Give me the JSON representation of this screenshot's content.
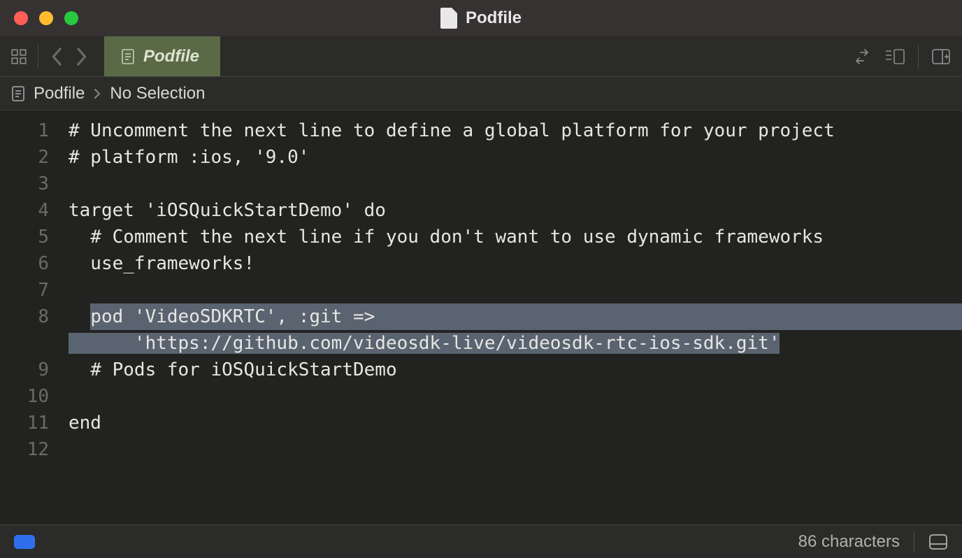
{
  "window": {
    "title": "Podfile"
  },
  "tab": {
    "label": "Podfile"
  },
  "breadcrumb": {
    "file": "Podfile",
    "sub": "No Selection"
  },
  "statusbar": {
    "chars": "86 characters"
  },
  "code": {
    "lines": [
      {
        "n": "1",
        "t": "# Uncomment the next line to define a global platform for your project"
      },
      {
        "n": "2",
        "t": "# platform :ios, '9.0'"
      },
      {
        "n": "3",
        "t": ""
      },
      {
        "n": "4",
        "t": "target 'iOSQuickStartDemo' do"
      },
      {
        "n": "5",
        "t": "  # Comment the next line if you don't want to use dynamic frameworks"
      },
      {
        "n": "6",
        "t": "  use_frameworks!"
      },
      {
        "n": "7",
        "t": ""
      },
      {
        "n": "8",
        "t": "  pod 'VideoSDKRTC', :git =>",
        "sel": true,
        "selFull": true
      },
      {
        "n": "",
        "t": "      'https://github.com/videosdk-live/videosdk-rtc-ios-sdk.git'",
        "sel": true,
        "selTo": 64
      },
      {
        "n": "9",
        "t": "  # Pods for iOSQuickStartDemo"
      },
      {
        "n": "10",
        "t": ""
      },
      {
        "n": "11",
        "t": "end"
      },
      {
        "n": "12",
        "t": ""
      }
    ]
  }
}
